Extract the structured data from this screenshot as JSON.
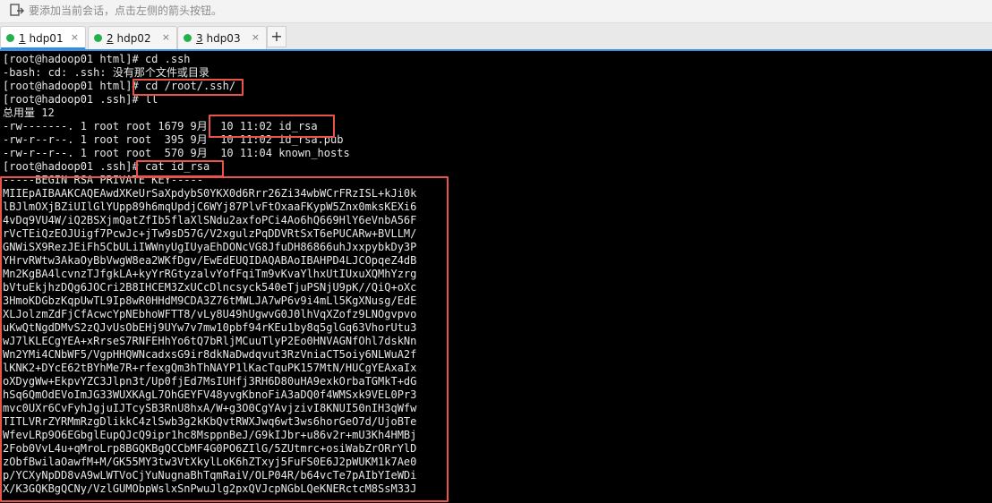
{
  "hint": {
    "text": "要添加当前会话，点击左侧的箭头按钮。"
  },
  "tabs": [
    {
      "number": "1",
      "name": "hdp01",
      "active": true,
      "status_color": "#22b14c"
    },
    {
      "number": "2",
      "name": "hdp02",
      "active": false,
      "status_color": "#22b14c"
    },
    {
      "number": "3",
      "name": "hdp03",
      "active": false,
      "status_color": "#22b14c"
    }
  ],
  "add_tab_label": "+",
  "close_glyph": "×",
  "terminal": {
    "lines": [
      "[root@hadoop01 html]# cd .ssh",
      "-bash: cd: .ssh: 没有那个文件或目录",
      "[root@hadoop01 html]# cd /root/.ssh/",
      "[root@hadoop01 .ssh]# ll",
      "总用量 12",
      "-rw-------. 1 root root 1679 9月  10 11:02 id_rsa",
      "-rw-r--r--. 1 root root  395 9月  10 11:02 id_rsa.pub",
      "-rw-r--r--. 1 root root  570 9月  10 11:04 known_hosts",
      "[root@hadoop01 .ssh]# cat id_rsa",
      "-----BEGIN RSA PRIVATE KEY-----",
      "MIIEpAIBAAKCAQEAwdXKeUrSaXpdybS0YKX0d6Rrr26Zi34wbWCrFRzISL+kJi0k",
      "lBJlmOXjBZiUIlGlYUpp89h6mqUpdjC6WYj87PlvFtOxaaFKypW5Znx0mksKEXi6",
      "4vDq9VU4W/iQ2BSXjmQatZfIb5flaXlSNdu2axfoPCi4Ao6hQ669HlY6eVnbA56F",
      "rVcTEiQzEOJUigf7PcwJc+jTw9sD57G/V2xgulzPqDDVRtSxT6ePUCARw+BVLLM/",
      "GNWiSX9RezJEiFh5CbULiIWWnyUgIUyaEhDONcVG8JfuDH86866uhJxxpybkDy3P",
      "YHrvRWtw3AkaOyBbVwgW8ea2WKfDgv/EwEdEUQIDAQABAoIBAHPD4LJCOpqeZ4dB",
      "Mn2KgBA4lcvnzTJfgkLA+kyYrRGtyzalvYofFqiTm9vKvaYlhxUtIUxuXQMhYzrg",
      "bVtuEkjhzDQg6JOCri2B8IHCEM3ZxUCcDlncsyck540eTjuPSNjU9pK//QiQ+oXc",
      "3HmoKDGbzKqpUwTL9Ip8wR0HHdM9CDA3Z76tMWLJA7wP6v9i4mLl5KgXNusg/EdE",
      "XLJolzmZdFjCfAcwcYpNEbhoWFTT8/vLy8U49hUgwvG0J0lhVqXZofz9LNOgvpvo",
      "uKwQtNgdDMvS2zQJvUsObEHj9UYw7v7mw10pbf94rKEu1by8q5glGq63VhorUtu3",
      "wJ7lKLECgYEA+xRrseS7RNFEHhYo6tQ7bRljMCuuTlyP2Eo0HNVAGNfOhl7dskNn",
      "Wn2YMi4CNbWF5/VgpHHQWNcadxsG9ir8dkNaDwdqvut3RzVniaCT5oiy6NLWuA2f",
      "lKNK2+DYcE62tBYhMe7R+rfexgQm3hThNAYP1lKacTquPK157MtN/HUCgYEAxaIx",
      "oXDygWw+EkpvYZC3Jlpn3t/Up0fjEd7MsIUHfj3RH6D80uHA9exkOrbaTGMkT+dG",
      "hSq6QmOdEVoImJG33WUXKAgL7OhGEYFV48yvgKbnoFiA3aDQ0f4WMSxk9VEL0Pr3",
      "mvc0UXr6CvFyhJgjuIJTcySB3RnU8hxA/W+g3O0CgYAvjzivI8KNUI50nIH3qWfw",
      "TITLVRrZYRMmRzgDlikkC4zlSwb3g2kKbQvtRWXJwq6wt3ws6horGeO7d/UjoBTe",
      "WfevLRp9O6EGbglEupQJcQ9ipr1hc8MsppnBeJ/G9kIJbr+u86v2r+mU3Kh4HMBj",
      "2Fob0VvL4u+qMroLrp8BGQKBgQCCbMF4G0PO6ZIlG/5ZUtmrc+osiWabZrORrYlD",
      "zObfBwilaOawfM+M/GK55MY3tw3VtXkylLoK6hZTxyj5FuFS0E6J2pWUKM1k7Ae0",
      "p/YCXyNpDD8vA9wLWTVoCjYuNugnaBhTqmRaiV/OLP04R/b64vcTe7pAIbYIeWDi",
      "X/K3GQKBgQCNy/VzlGUMObpWslxSnPwuJlg2pxQVJcpNGbLQeKNERctcM8SsM33J"
    ]
  }
}
